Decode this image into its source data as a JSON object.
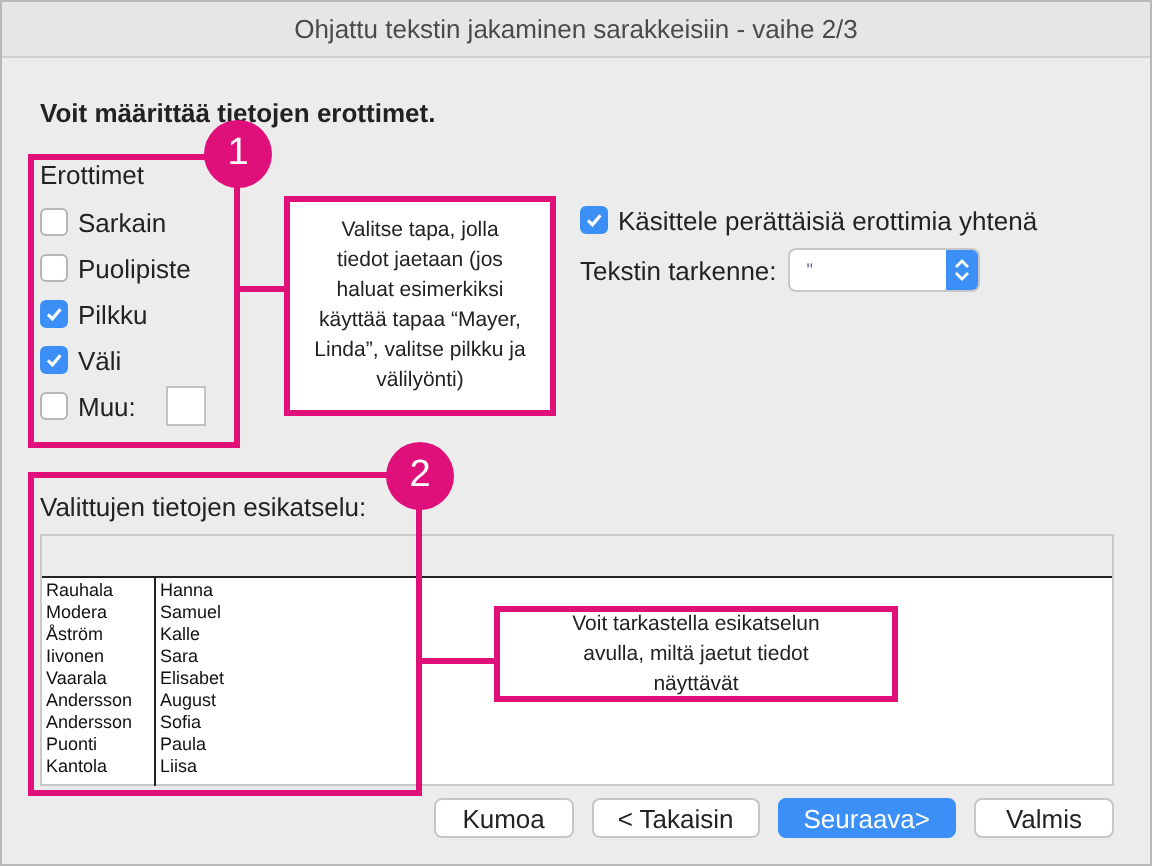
{
  "window": {
    "title": "Ohjattu tekstin jakaminen sarakkeisiin - vaihe 2/3"
  },
  "heading": "Voit määrittää tietojen erottimet.",
  "delimiters": {
    "label": "Erottimet",
    "options": [
      {
        "kind": "check",
        "label": "Sarkain",
        "checked": false
      },
      {
        "kind": "check",
        "label": "Puolipiste",
        "checked": false
      },
      {
        "kind": "check",
        "label": "Pilkku",
        "checked": true
      },
      {
        "kind": "check",
        "label": "Väli",
        "checked": true
      },
      {
        "kind": "other",
        "label": "Muu:",
        "checked": false
      }
    ]
  },
  "consecutive": {
    "label": "Käsittele perättäisiä erottimia yhtenä",
    "checked": true
  },
  "qualifier": {
    "label": "Tekstin tarkenne:",
    "value": "\""
  },
  "preview": {
    "label": "Valittujen tietojen esikatselu:",
    "rows": [
      [
        "Rauhala",
        "Hanna"
      ],
      [
        "Modera",
        "Samuel"
      ],
      [
        "Åström",
        "Kalle"
      ],
      [
        "Iivonen",
        "Sara"
      ],
      [
        "Vaarala",
        "Elisabet"
      ],
      [
        "Andersson",
        "August"
      ],
      [
        "Andersson",
        "Sofia"
      ],
      [
        "Puonti",
        "Paula"
      ],
      [
        "Kantola",
        "Liisa"
      ]
    ]
  },
  "buttons": [
    {
      "label": "Kumoa",
      "primary": false
    },
    {
      "label": "< Takaisin",
      "primary": false
    },
    {
      "label": "Seuraava>",
      "primary": true
    },
    {
      "label": "Valmis",
      "primary": false
    }
  ],
  "callouts": [
    {
      "number": "1",
      "text": "Valitse tapa, jolla tiedot jaetaan (jos haluat esimerkiksi käyttää tapaa “Mayer, Linda”, valitse pilkku ja välilyönti)"
    },
    {
      "number": "2",
      "text": "Voit tarkastella esikatselun avulla, miltä jaetut tiedot näyttävät"
    }
  ]
}
